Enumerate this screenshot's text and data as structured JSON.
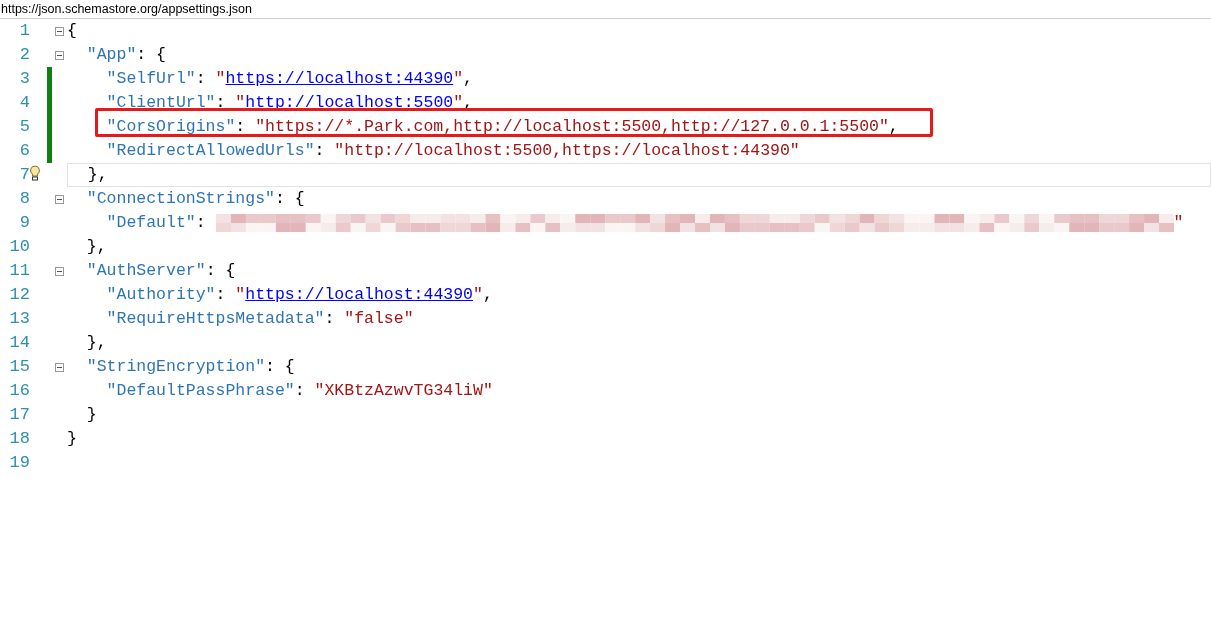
{
  "address_bar": {
    "url": "https://json.schemastore.org/appsettings.json"
  },
  "lines": [
    {
      "number": "1",
      "fold": true,
      "changed": false,
      "current": false,
      "lightbulb": false,
      "highlighted": false,
      "tokens": [
        {
          "kind": "punct",
          "text": "{"
        }
      ]
    },
    {
      "number": "2",
      "fold": true,
      "changed": false,
      "current": false,
      "lightbulb": false,
      "highlighted": false,
      "tokens": [
        {
          "kind": "key",
          "text": "  \"App\""
        },
        {
          "kind": "punct",
          "text": ": {"
        }
      ]
    },
    {
      "number": "3",
      "fold": false,
      "changed": true,
      "current": false,
      "lightbulb": false,
      "highlighted": false,
      "tokens": [
        {
          "kind": "key",
          "text": "    \"SelfUrl\""
        },
        {
          "kind": "punct",
          "text": ": "
        },
        {
          "kind": "string",
          "text": "\""
        },
        {
          "kind": "link",
          "text": "https://localhost:44390"
        },
        {
          "kind": "string",
          "text": "\""
        },
        {
          "kind": "punct",
          "text": ","
        }
      ]
    },
    {
      "number": "4",
      "fold": false,
      "changed": true,
      "current": false,
      "lightbulb": false,
      "highlighted": false,
      "tokens": [
        {
          "kind": "key",
          "text": "    \"ClientUrl\""
        },
        {
          "kind": "punct",
          "text": ": "
        },
        {
          "kind": "string",
          "text": "\""
        },
        {
          "kind": "link",
          "text": "http://localhost:5500"
        },
        {
          "kind": "string",
          "text": "\""
        },
        {
          "kind": "punct",
          "text": ","
        }
      ]
    },
    {
      "number": "5",
      "fold": false,
      "changed": true,
      "current": false,
      "lightbulb": false,
      "highlighted": true,
      "tokens": [
        {
          "kind": "key",
          "text": "    \"CorsOrigins\""
        },
        {
          "kind": "punct",
          "text": ": "
        },
        {
          "kind": "string",
          "text": "\"https://*.Park.com,http://localhost:5500,http://127.0.0.1:5500\""
        },
        {
          "kind": "punct",
          "text": ","
        }
      ]
    },
    {
      "number": "6",
      "fold": false,
      "changed": true,
      "current": false,
      "lightbulb": false,
      "highlighted": false,
      "tokens": [
        {
          "kind": "key",
          "text": "    \"RedirectAllowedUrls\""
        },
        {
          "kind": "punct",
          "text": ": "
        },
        {
          "kind": "string",
          "text": "\"http://localhost:5500,https://localhost:44390\""
        }
      ]
    },
    {
      "number": "7",
      "fold": false,
      "changed": false,
      "current": true,
      "lightbulb": true,
      "highlighted": false,
      "tokens": [
        {
          "kind": "punct",
          "text": "  },"
        }
      ]
    },
    {
      "number": "8",
      "fold": true,
      "changed": false,
      "current": false,
      "lightbulb": false,
      "highlighted": false,
      "tokens": [
        {
          "kind": "key",
          "text": "  \"ConnectionStrings\""
        },
        {
          "kind": "punct",
          "text": ": {"
        }
      ]
    },
    {
      "number": "9",
      "fold": false,
      "changed": false,
      "current": false,
      "lightbulb": false,
      "highlighted": false,
      "tokens": [
        {
          "kind": "key",
          "text": "    \"Default\""
        },
        {
          "kind": "punct",
          "text": ": "
        },
        {
          "kind": "redacted"
        },
        {
          "kind": "string",
          "text": "\""
        }
      ]
    },
    {
      "number": "10",
      "fold": false,
      "changed": false,
      "current": false,
      "lightbulb": false,
      "highlighted": false,
      "tokens": [
        {
          "kind": "punct",
          "text": "  },"
        }
      ]
    },
    {
      "number": "11",
      "fold": true,
      "changed": false,
      "current": false,
      "lightbulb": false,
      "highlighted": false,
      "tokens": [
        {
          "kind": "key",
          "text": "  \"AuthServer\""
        },
        {
          "kind": "punct",
          "text": ": {"
        }
      ]
    },
    {
      "number": "12",
      "fold": false,
      "changed": false,
      "current": false,
      "lightbulb": false,
      "highlighted": false,
      "tokens": [
        {
          "kind": "key",
          "text": "    \"Authority\""
        },
        {
          "kind": "punct",
          "text": ": "
        },
        {
          "kind": "string",
          "text": "\""
        },
        {
          "kind": "link",
          "text": "https://localhost:44390"
        },
        {
          "kind": "string",
          "text": "\""
        },
        {
          "kind": "punct",
          "text": ","
        }
      ]
    },
    {
      "number": "13",
      "fold": false,
      "changed": false,
      "current": false,
      "lightbulb": false,
      "highlighted": false,
      "tokens": [
        {
          "kind": "key",
          "text": "    \"RequireHttpsMetadata\""
        },
        {
          "kind": "punct",
          "text": ": "
        },
        {
          "kind": "string",
          "text": "\"false\""
        }
      ]
    },
    {
      "number": "14",
      "fold": false,
      "changed": false,
      "current": false,
      "lightbulb": false,
      "highlighted": false,
      "tokens": [
        {
          "kind": "punct",
          "text": "  },"
        }
      ]
    },
    {
      "number": "15",
      "fold": true,
      "changed": false,
      "current": false,
      "lightbulb": false,
      "highlighted": false,
      "tokens": [
        {
          "kind": "key",
          "text": "  \"StringEncryption\""
        },
        {
          "kind": "punct",
          "text": ": {"
        }
      ]
    },
    {
      "number": "16",
      "fold": false,
      "changed": false,
      "current": false,
      "lightbulb": false,
      "highlighted": false,
      "tokens": [
        {
          "kind": "key",
          "text": "    \"DefaultPassPhrase\""
        },
        {
          "kind": "punct",
          "text": ": "
        },
        {
          "kind": "string",
          "text": "\"XKBtzAzwvTG34liW\""
        }
      ]
    },
    {
      "number": "17",
      "fold": false,
      "changed": false,
      "current": false,
      "lightbulb": false,
      "highlighted": false,
      "tokens": [
        {
          "kind": "punct",
          "text": "  }"
        }
      ]
    },
    {
      "number": "18",
      "fold": false,
      "changed": false,
      "current": false,
      "lightbulb": false,
      "highlighted": false,
      "tokens": [
        {
          "kind": "punct",
          "text": "}"
        }
      ]
    },
    {
      "number": "19",
      "fold": false,
      "changed": false,
      "current": false,
      "lightbulb": false,
      "highlighted": false
    }
  ]
}
